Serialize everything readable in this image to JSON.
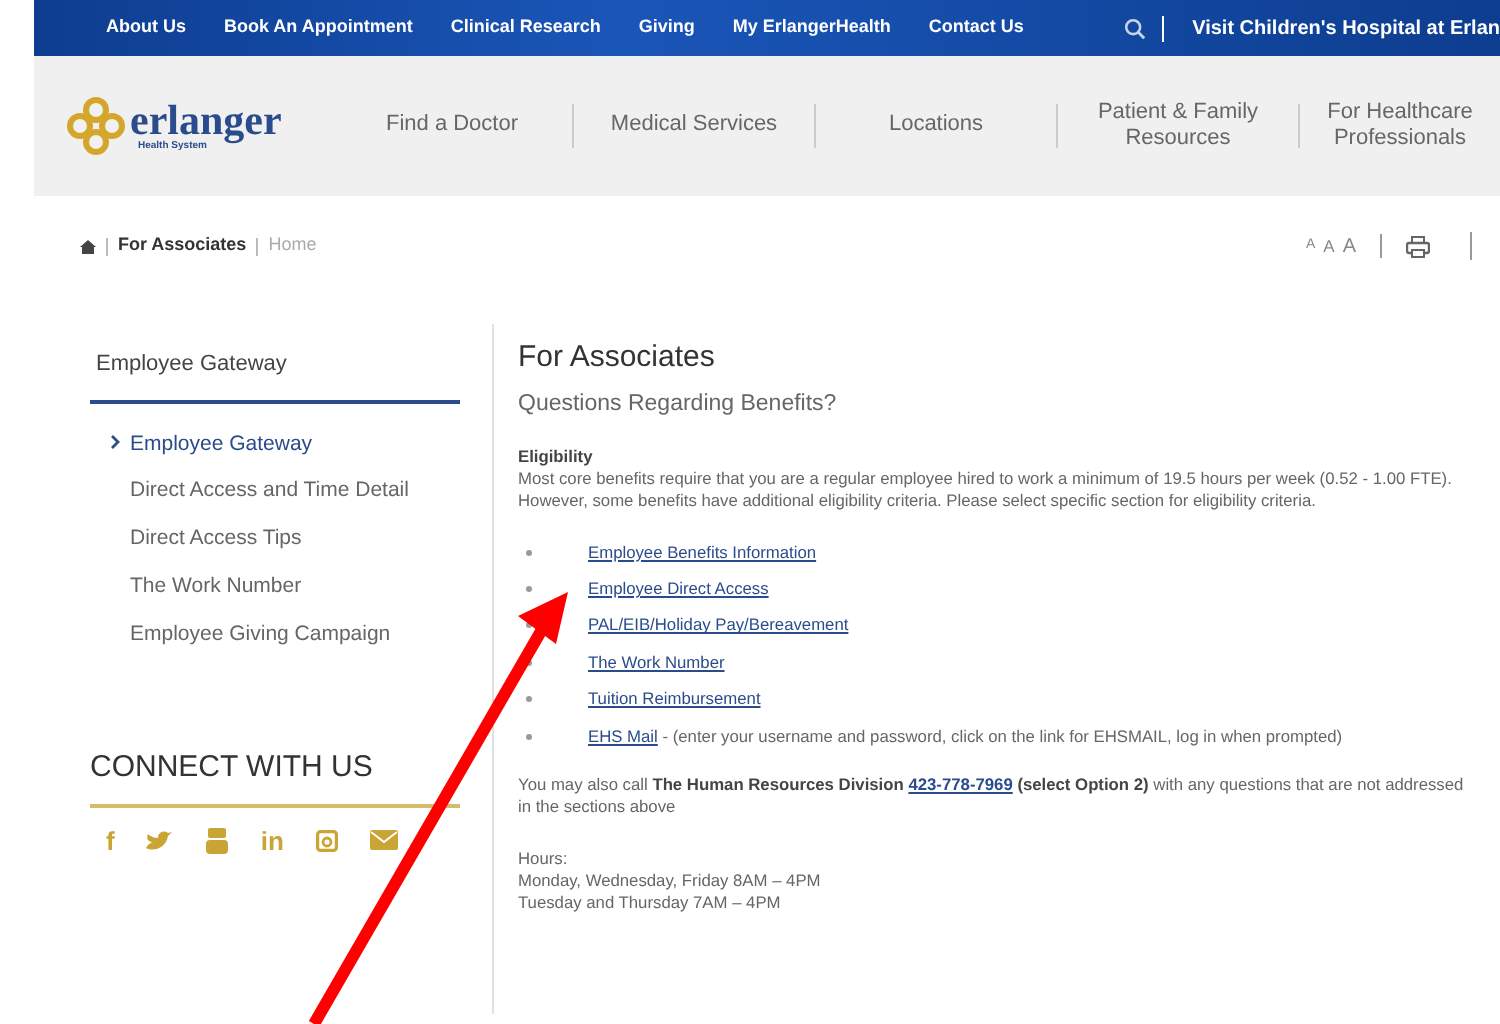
{
  "top_bar": {
    "links": [
      "About Us",
      "Book An Appointment",
      "Clinical Research",
      "Giving",
      "My ErlangerHealth",
      "Contact Us"
    ],
    "visit": "Visit Children's Hospital at Erlan"
  },
  "header": {
    "logo": {
      "name": "erlanger",
      "tagline": "Health System"
    },
    "nav": [
      "Find a Doctor",
      "Medical Services",
      "Locations",
      "Patient & Family Resources",
      "For Healthcare Professionals"
    ]
  },
  "breadcrumb": {
    "current": "For Associates",
    "home": "Home"
  },
  "text_sizes": [
    "A",
    "A",
    "A"
  ],
  "sidebar": {
    "title": "Employee Gateway",
    "items": [
      {
        "label": "Employee Gateway",
        "selected": true
      },
      {
        "label": "Direct Access and Time Detail",
        "selected": false
      },
      {
        "label": "Direct Access Tips",
        "selected": false
      },
      {
        "label": "The Work Number",
        "selected": false
      },
      {
        "label": "Employee Giving Campaign",
        "selected": false
      }
    ],
    "connect_title": "CONNECT WITH US",
    "social": [
      {
        "kind": "text",
        "text": "f"
      },
      {
        "kind": "bird"
      },
      {
        "kind": "video"
      },
      {
        "kind": "text",
        "text": "in"
      },
      {
        "kind": "camera"
      },
      {
        "kind": "mail"
      }
    ]
  },
  "content": {
    "title": "For Associates",
    "subtitle": "Questions Regarding Benefits?",
    "eligibility_label": "Eligibility",
    "eligibility_text": "Most core benefits require that you are a regular employee hired to work a minimum of 19.5 hours per week (0.52 - 1.00 FTE). However, some benefits have additional eligibility criteria.  Please select specific section for eligibility criteria.",
    "links": [
      {
        "label": "Employee Benefits Information"
      },
      {
        "label": "Employee Direct Access"
      },
      {
        "label": "PAL/EIB/Holiday Pay/Bereavement"
      },
      {
        "label": "The Work Number"
      },
      {
        "label": "Tuition Reimbursement"
      },
      {
        "label": "EHS Mail",
        "note": " - (enter your username and password, click on the link for EHSMAIL, log in when prompted)"
      }
    ],
    "call_before": "You may also call **The Human Resources Division** ",
    "phone": "423-778-7969",
    "call_after": " **(select Option 2)** with any questions that are not addressed in the sections above",
    "hours_label": "Hours:",
    "hours": [
      "Monday, Wednesday, Friday 8AM – 4PM",
      "Tuesday and Thursday 7AM – 4PM"
    ]
  }
}
